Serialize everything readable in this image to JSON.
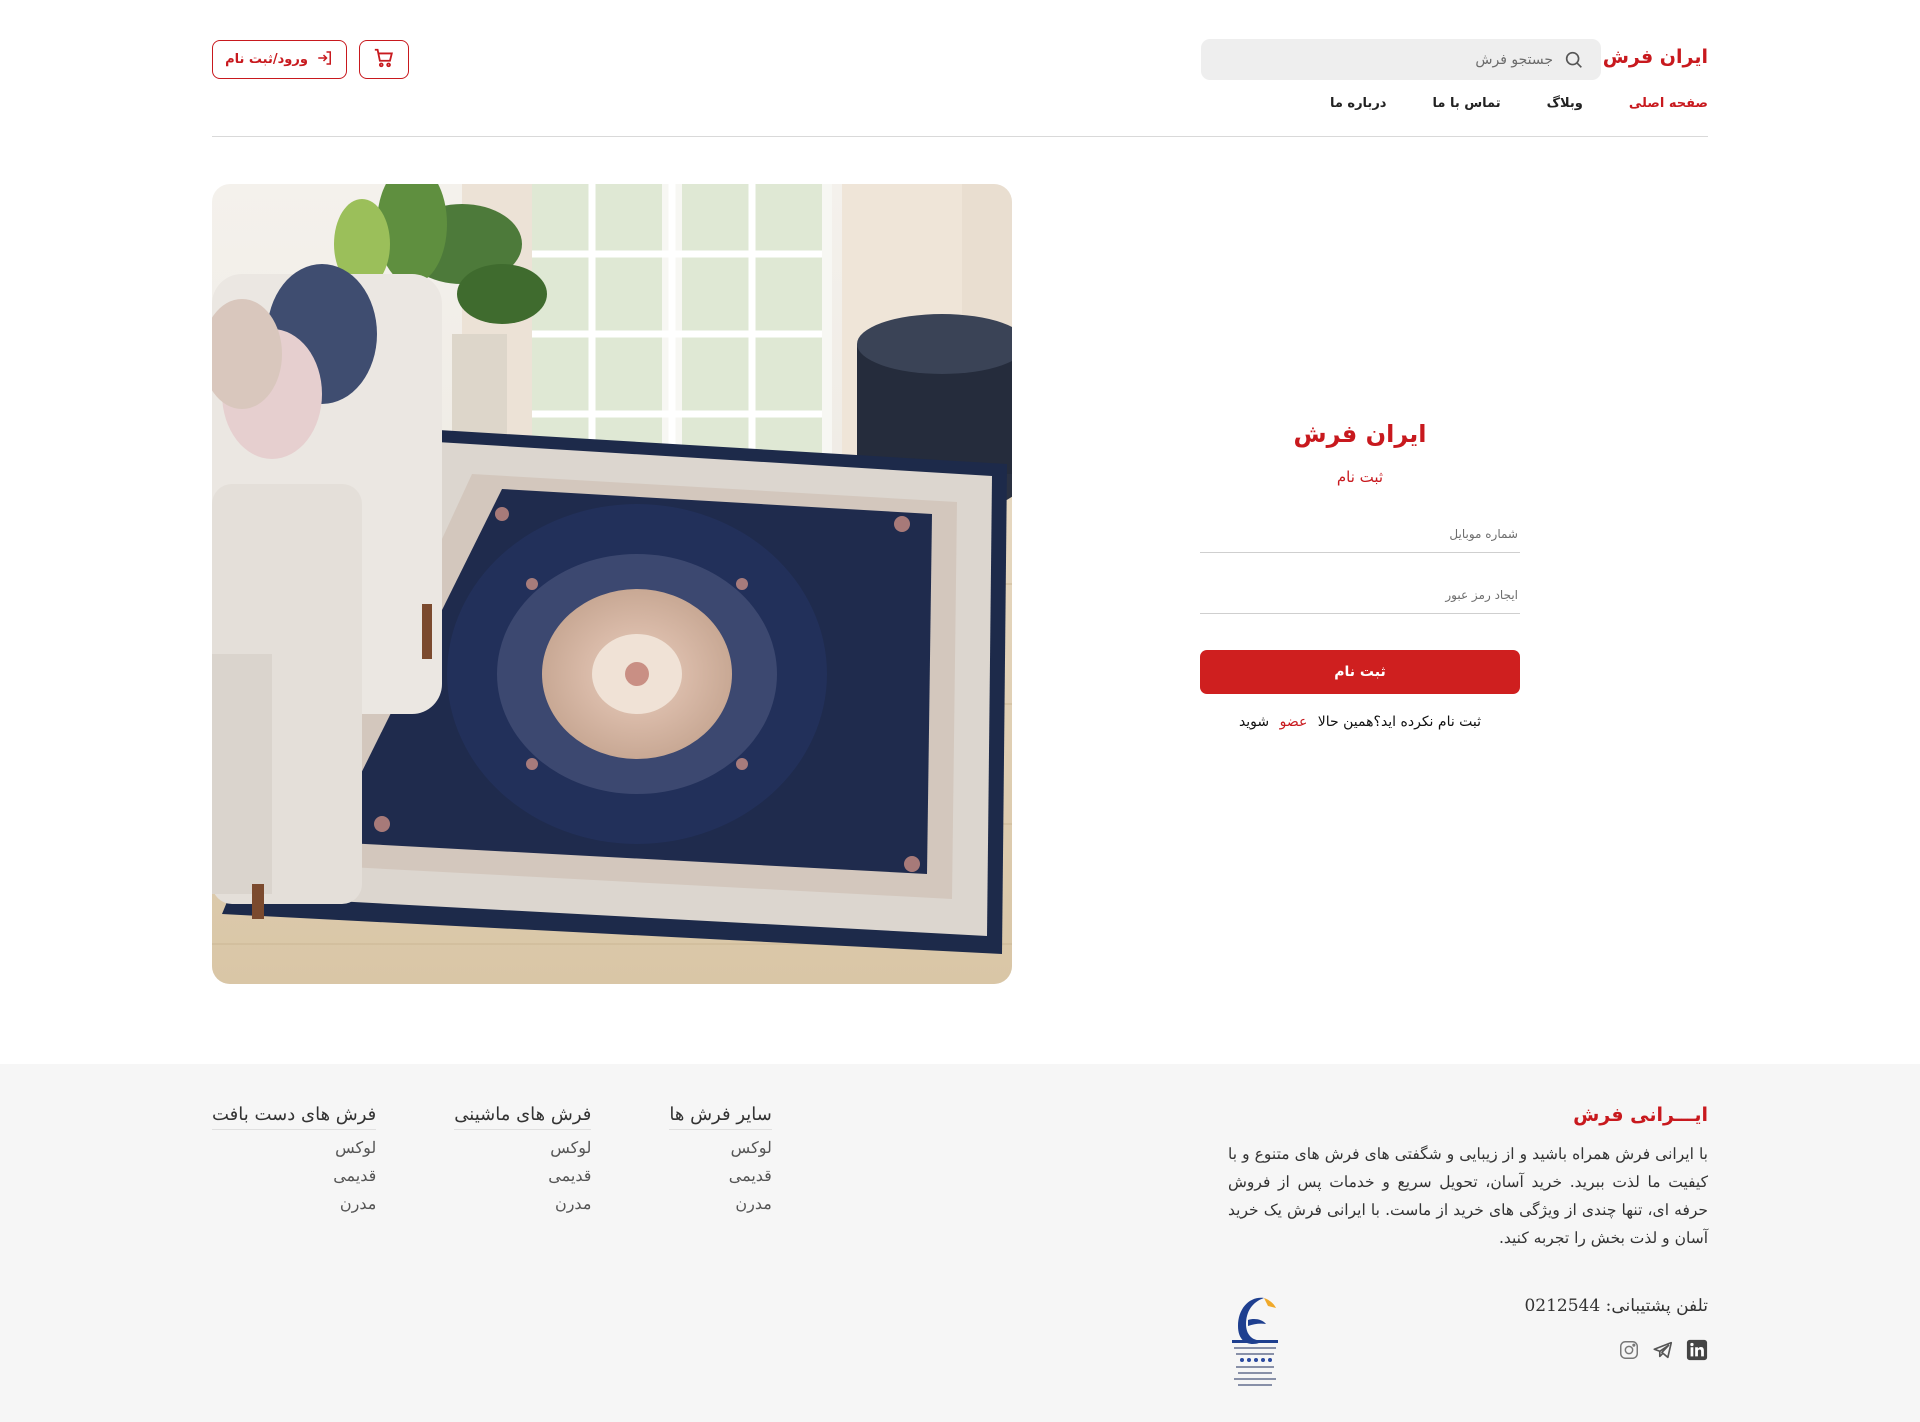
{
  "header": {
    "brand": "ایران فرش",
    "search_placeholder": "جستجو فرش",
    "login_label": "ورود/ثبت نام",
    "nav": [
      {
        "label": "صفحه اصلی"
      },
      {
        "label": "وبلاگ"
      },
      {
        "label": "تماس با ما"
      },
      {
        "label": "درباره ما"
      }
    ]
  },
  "form": {
    "brand": "ایران فرش",
    "subtitle": "ثبت نام",
    "mobile_placeholder": "شماره موبایل",
    "password_placeholder": "ایجاد رمز عبور",
    "submit_label": "ثبت نام",
    "join_prefix": "ثبت نام نکرده اید؟همین حالا",
    "join_link": "عضو",
    "join_suffix": "شوید"
  },
  "footer": {
    "brand": "ایـــرانی فرش",
    "description": "با ایرانی فرش همراه باشید و از زیبایی و شگفتی های فرش های متنوع و با کیفیت ما لذت ببرید. خرید آسان، تحویل سریع و خدمات پس از فروش حرفه ای، تنها چندی از ویژگی های خرید از ماست. با ایرانی فرش یک خرید آسان و لذت بخش را تجربه کنید.",
    "phone": "تلفن پشتیبانی: 0212544",
    "columns": [
      {
        "title": "فرش های دست بافت",
        "links": [
          "لوکس",
          "قدیمی",
          "مدرن"
        ]
      },
      {
        "title": "فرش های ماشینی",
        "links": [
          "لوکس",
          "قدیمی",
          "مدرن"
        ]
      },
      {
        "title": "سایر فرش ها",
        "links": [
          "لوکس",
          "قدیمی",
          "مدرن"
        ]
      }
    ],
    "socials": [
      "linkedin-icon",
      "telegram-icon",
      "instagram-icon"
    ]
  },
  "colors": {
    "accent": "#c8191e",
    "footer_bg": "#f6f6f6"
  }
}
